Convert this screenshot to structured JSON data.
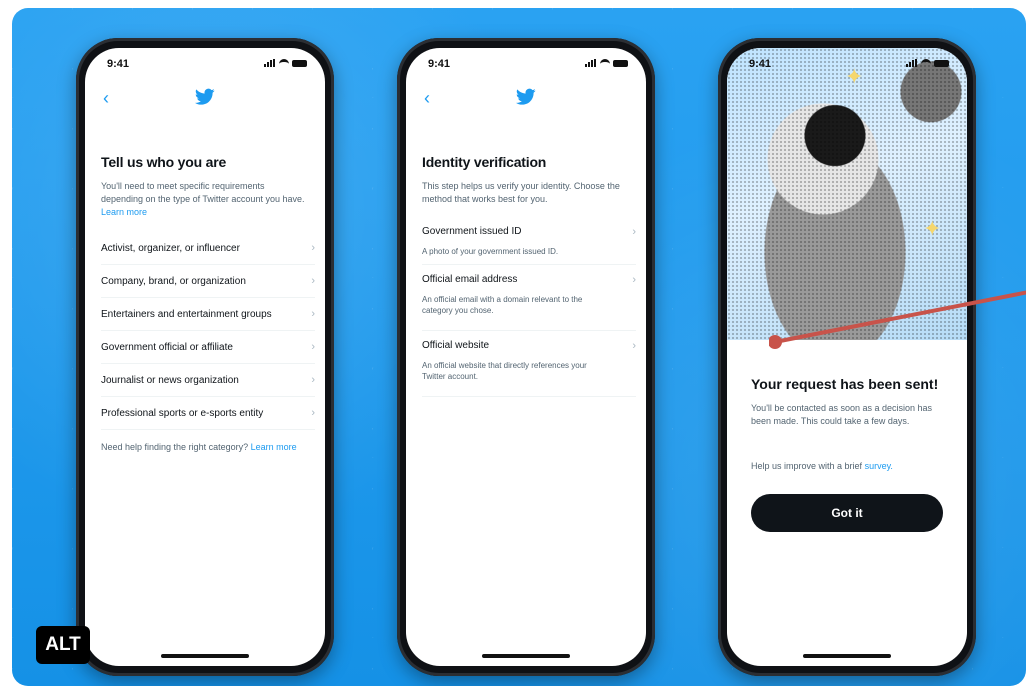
{
  "status_time": "9:41",
  "colors": {
    "twitter_blue": "#1d9bf0",
    "bg": "#1d9bf0",
    "pointer": "#c8534a"
  },
  "phone1": {
    "title": "Tell us who you are",
    "desc": "You'll need to meet specific requirements depending on the type of Twitter account you have.",
    "desc_link": "Learn more",
    "items": [
      "Activist, organizer, or influencer",
      "Company, brand, or organization",
      "Entertainers and entertainment groups",
      "Government official or affiliate",
      "Journalist or news organization",
      "Professional sports or e-sports entity"
    ],
    "help": "Need help finding the right category?",
    "help_link": "Learn more"
  },
  "phone2": {
    "title": "Identity verification",
    "desc": "This step helps us verify your identity. Choose the method that works best for you.",
    "options": [
      {
        "title": "Government issued ID",
        "sub": "A photo of your government issued ID."
      },
      {
        "title": "Official email address",
        "sub": "An official email with a domain relevant to the category you chose."
      },
      {
        "title": "Official website",
        "sub": "An official website that directly references your Twitter account."
      }
    ]
  },
  "phone3": {
    "title": "Your request has been sent!",
    "desc": "You'll be contacted as soon as a decision has been made. This could take a few days.",
    "survey_text": "Help us improve with a brief",
    "survey_link": "survey.",
    "button": "Got it"
  },
  "alt_badge": "ALT"
}
